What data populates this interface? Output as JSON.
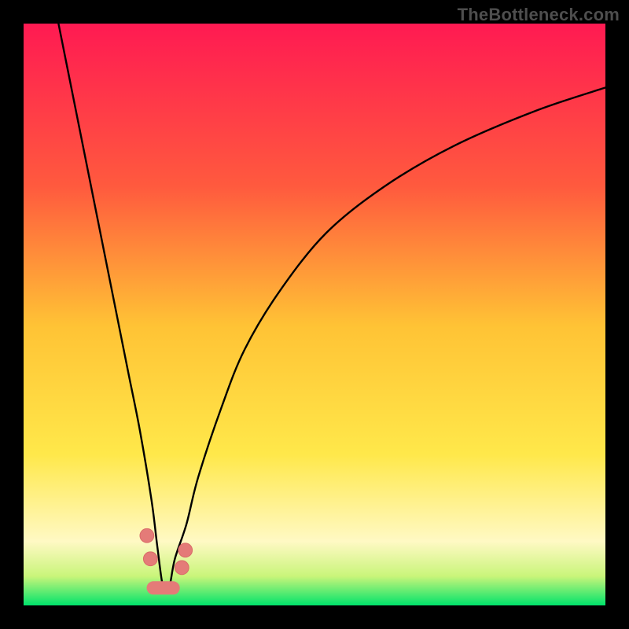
{
  "watermark": "TheBottleneck.com",
  "colors": {
    "frame": "#000000",
    "gradient_top": "#ff1a52",
    "gradient_upper": "#ff6a3a",
    "gradient_mid": "#ffc335",
    "gradient_lower": "#ffe84a",
    "gradient_pale": "#fff9c4",
    "gradient_green": "#00e36b",
    "curve": "#000000",
    "marker_fill": "#e47b78",
    "marker_stroke": "#d96b68"
  },
  "chart_data": {
    "type": "line",
    "title": "",
    "xlabel": "",
    "ylabel": "",
    "xlim": [
      0,
      100
    ],
    "ylim": [
      0,
      100
    ],
    "watermark": "TheBottleneck.com",
    "minimum_x": 24,
    "series": [
      {
        "name": "bottleneck-curve",
        "x": [
          6,
          8,
          10,
          12,
          14,
          16,
          18,
          20,
          22,
          23,
          24,
          25,
          26,
          28,
          30,
          34,
          38,
          44,
          52,
          62,
          74,
          88,
          100
        ],
        "values": [
          100,
          90,
          80,
          70,
          60,
          50,
          40,
          30,
          18,
          10,
          3,
          3,
          8,
          14,
          22,
          34,
          44,
          54,
          64,
          72,
          79,
          85,
          89
        ]
      }
    ],
    "markers": [
      {
        "name": "left-dot-upper",
        "x": 21.2,
        "y": 12.0,
        "r": 1.2
      },
      {
        "name": "left-dot-lower",
        "x": 21.8,
        "y": 8.0,
        "r": 1.2
      },
      {
        "name": "right-dot-upper",
        "x": 27.8,
        "y": 9.5,
        "r": 1.2
      },
      {
        "name": "right-dot-lower",
        "x": 27.2,
        "y": 6.5,
        "r": 1.2
      },
      {
        "name": "bottom-capsule",
        "type": "capsule",
        "x0": 22.3,
        "y0": 3.0,
        "x1": 25.7,
        "y1": 3.0,
        "thickness": 2.3
      }
    ]
  }
}
